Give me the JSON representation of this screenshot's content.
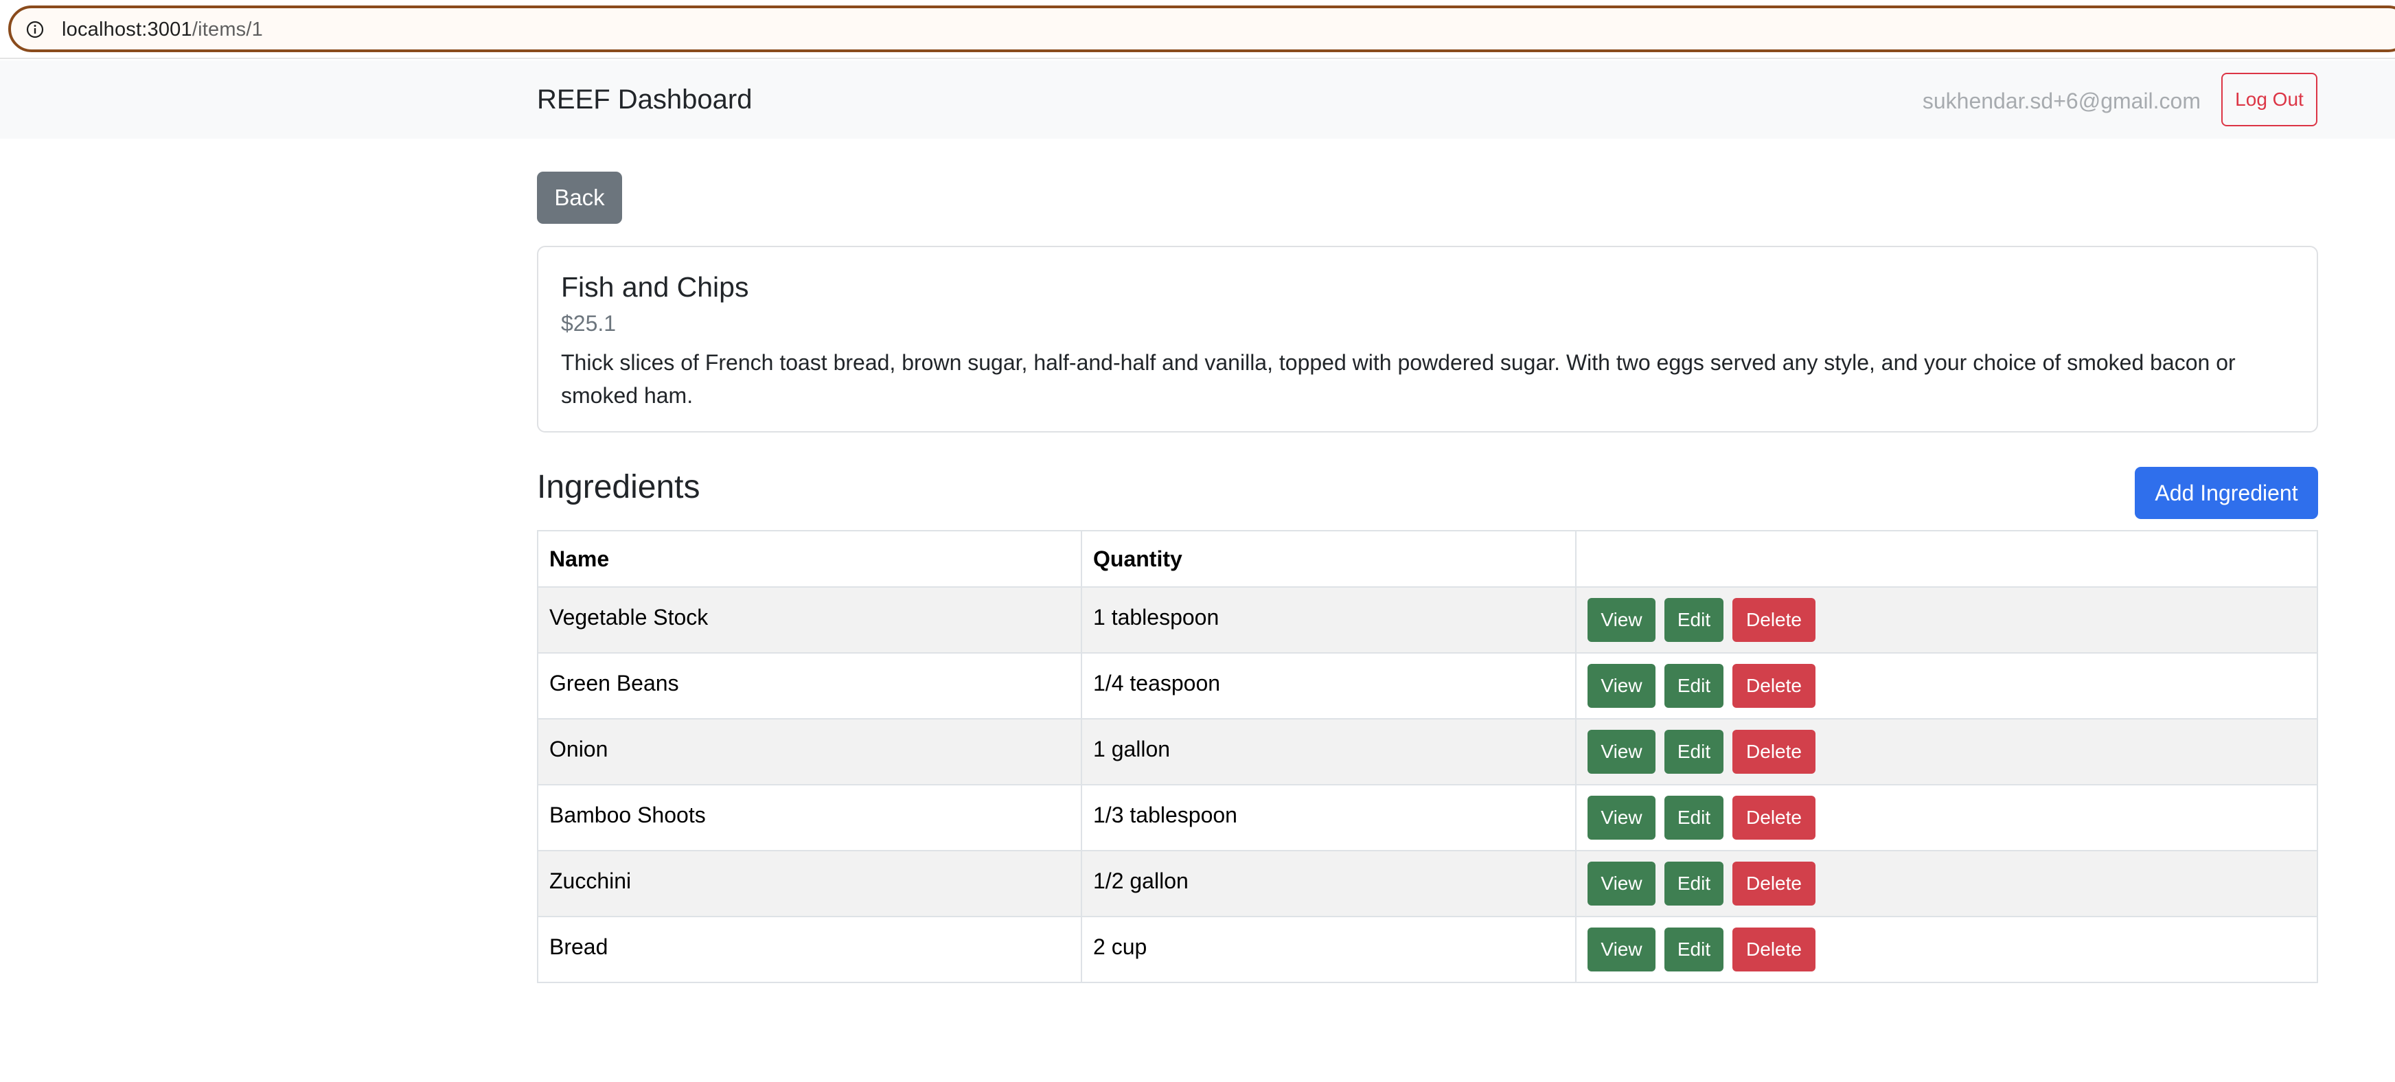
{
  "browser": {
    "url_host": "localhost:3001",
    "url_path": "/items/1",
    "icons": {
      "info": "info-circle-icon"
    }
  },
  "navbar": {
    "brand": "REEF Dashboard",
    "user_email": "sukhendar.sd+6@gmail.com",
    "logout_label": "Log Out"
  },
  "back_label": "Back",
  "item": {
    "name": "Fish and Chips",
    "price": "$25.1",
    "description": "Thick slices of French toast bread, brown sugar, half-and-half and vanilla, topped with powdered sugar. With two eggs served any style, and your choice of smoked bacon or smoked ham."
  },
  "ingredients": {
    "title": "Ingredients",
    "add_label": "Add Ingredient",
    "columns": [
      "Name",
      "Quantity",
      ""
    ],
    "actions": {
      "view": "View",
      "edit": "Edit",
      "delete": "Delete"
    },
    "rows": [
      {
        "name": "Vegetable Stock",
        "quantity": "1 tablespoon"
      },
      {
        "name": "Green Beans",
        "quantity": "1/4 teaspoon"
      },
      {
        "name": "Onion",
        "quantity": "1 gallon"
      },
      {
        "name": "Bamboo Shoots",
        "quantity": "1/3 tablespoon"
      },
      {
        "name": "Zucchini",
        "quantity": "1/2 gallon"
      },
      {
        "name": "Bread",
        "quantity": "2 cup"
      }
    ]
  },
  "colors": {
    "primary": "#2f6fec",
    "secondary": "#6c757d",
    "success": "#3f7f52",
    "danger": "#d2404b",
    "navbar_bg": "#f8f9fa"
  }
}
